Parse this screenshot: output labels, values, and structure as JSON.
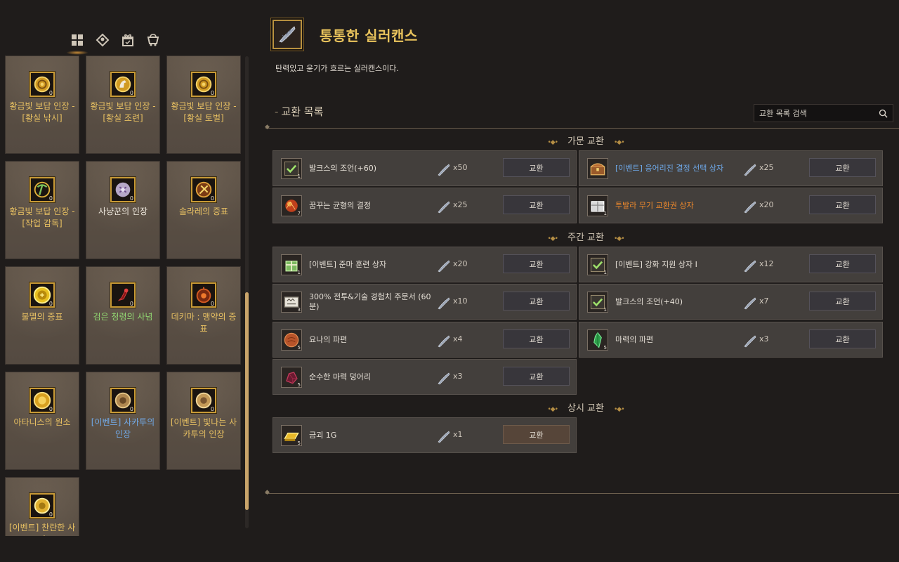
{
  "tabs": [
    {
      "icon": "grid-icon"
    },
    {
      "icon": "tag-icon"
    },
    {
      "icon": "gift-icon"
    },
    {
      "icon": "cart-icon"
    }
  ],
  "cards": [
    {
      "name": "황금빛 보답 인장 - [황실 낚시]",
      "count": "0",
      "color": "gold",
      "icon": "gold-seal-icon"
    },
    {
      "name": "황금빛 보답 인장 - [황실 조련]",
      "count": "0",
      "color": "gold",
      "icon": "gold-seal-horse-icon"
    },
    {
      "name": "황금빛 보답 인장 - [황실 토벌]",
      "count": "0",
      "color": "gold",
      "icon": "gold-seal-icon"
    },
    {
      "name": "황금빛 보답 인장 - [작업 감독]",
      "count": "0",
      "color": "gold",
      "icon": "gold-seal-pick-icon"
    },
    {
      "name": "사냥꾼의 인장",
      "count": "0",
      "color": "white",
      "icon": "hunter-seal-icon"
    },
    {
      "name": "솔라레의 증표",
      "count": "0",
      "color": "gold",
      "icon": "solare-token-icon"
    },
    {
      "name": "불멸의 증표",
      "count": "0",
      "color": "gold",
      "icon": "immortal-token-icon"
    },
    {
      "name": "검은 청령의 사념",
      "count": "0",
      "color": "green",
      "icon": "dark-spirit-icon"
    },
    {
      "name": "데키마 : 맹약의 증표",
      "count": "0",
      "color": "gold",
      "icon": "dekima-token-icon"
    },
    {
      "name": "아타니스의 원소",
      "count": "0",
      "color": "gold",
      "icon": "atanis-element-icon"
    },
    {
      "name": "[이벤트] 사카투의 인장",
      "count": "0",
      "color": "blue",
      "icon": "sakatu-seal-icon"
    },
    {
      "name": "[이벤트] 빛나는 사카투의 인장",
      "count": "0",
      "color": "gold",
      "icon": "shining-sakatu-seal-icon"
    },
    {
      "name": "[이벤트] 찬란한 사카",
      "count": "0",
      "color": "gold",
      "icon": "brilliant-sakatu-icon"
    }
  ],
  "item": {
    "title": "통통한 실러캔스",
    "description": "탄력있고 윤기가 흐르는 실러캔스이다.",
    "icon": "coelacanth-icon"
  },
  "exchange": {
    "title": "교환 목록",
    "search_placeholder": "교환 목록 검색",
    "button_label": "교환",
    "cost_icon": "coelacanth-icon",
    "groups": [
      {
        "title": "가문 교환",
        "rows": [
          {
            "name": "발크스의 조언(+60)",
            "cost": "x50",
            "count": "1",
            "color": "white",
            "icon": "check-scroll-icon"
          },
          {
            "name": "[이벤트] 응어리진 결정 선택 상자",
            "cost": "x25",
            "count": "",
            "color": "blue",
            "icon": "treasure-chest-icon"
          },
          {
            "name": "꿈꾸는 균형의 결정",
            "cost": "x25",
            "count": "7",
            "color": "white",
            "icon": "dream-crystal-icon"
          },
          {
            "name": "투발라 무기 교환권 상자",
            "cost": "x20",
            "count": "1",
            "color": "orange",
            "icon": "tuvala-box-icon"
          }
        ]
      },
      {
        "title": "주간 교환",
        "rows": [
          {
            "name": "[이벤트] 준마 훈련 상자",
            "cost": "x20",
            "count": "1",
            "color": "white",
            "icon": "green-gift-box-icon"
          },
          {
            "name": "[이벤트] 강화 지원 상자 I",
            "cost": "x12",
            "count": "1",
            "color": "white",
            "icon": "check-scroll-icon"
          },
          {
            "name": "300% 전투&기술 경험치 주문서 (60분)",
            "cost": "x10",
            "count": "3",
            "color": "white",
            "icon": "exp-scroll-icon"
          },
          {
            "name": "발크스의 조언(+40)",
            "cost": "x7",
            "count": "1",
            "color": "white",
            "icon": "check-scroll-icon"
          },
          {
            "name": "요나의 파편",
            "cost": "x4",
            "count": "5",
            "color": "white",
            "icon": "yona-fragment-icon"
          },
          {
            "name": "마력의 파편",
            "cost": "x3",
            "count": "5",
            "color": "white",
            "icon": "green-crystal-icon"
          },
          {
            "name": "순수한 마력 덩어리",
            "cost": "x3",
            "count": "5",
            "color": "white",
            "icon": "pure-magic-ore-icon"
          }
        ]
      },
      {
        "title": "상시 교환",
        "rows": [
          {
            "name": "금괴 1G",
            "cost": "x1",
            "count": "5",
            "color": "white",
            "icon": "gold-bar-icon"
          }
        ]
      }
    ]
  },
  "colors": {
    "accent_gold": "#e9c35c",
    "event_blue": "#6ea8e8",
    "orange": "#f08a2c",
    "green": "#8fd870",
    "panel_bg": "#1f1c1b",
    "row_bg": "#433f3c"
  }
}
